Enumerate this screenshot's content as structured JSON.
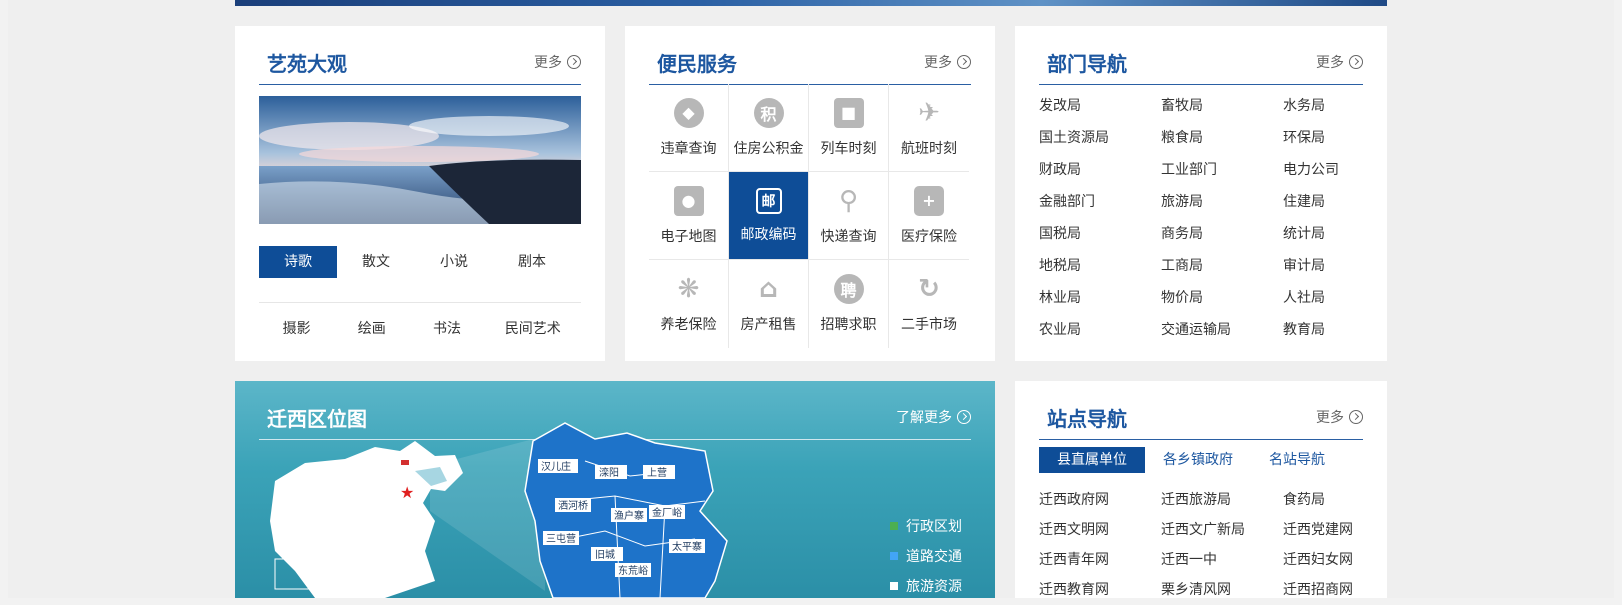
{
  "common": {
    "more_label": "更多"
  },
  "art": {
    "title": "艺苑大观",
    "tabs_row1": [
      "诗歌",
      "散文",
      "小说",
      "剧本"
    ],
    "tabs_row2": [
      "摄影",
      "绘画",
      "书法",
      "民间艺术"
    ],
    "active_tab": "诗歌"
  },
  "service": {
    "title": "便民服务",
    "items": [
      {
        "label": "违章查询",
        "icon": "car-icon"
      },
      {
        "label": "住房公积金",
        "icon": "ji-badge-icon",
        "glyph": "积"
      },
      {
        "label": "列车时刻",
        "icon": "train-icon"
      },
      {
        "label": "航班时刻",
        "icon": "plane-icon"
      },
      {
        "label": "电子地图",
        "icon": "map-pin-icon"
      },
      {
        "label": "邮政编码",
        "icon": "postal-icon",
        "glyph": "邮"
      },
      {
        "label": "快递查询",
        "icon": "search-icon"
      },
      {
        "label": "医疗保险",
        "icon": "medical-kit-icon"
      },
      {
        "label": "养老保险",
        "icon": "asterisk-icon"
      },
      {
        "label": "房产租售",
        "icon": "house-icon"
      },
      {
        "label": "招聘求职",
        "icon": "pin-badge-icon",
        "glyph": "聘"
      },
      {
        "label": "二手市场",
        "icon": "recycle-icon"
      }
    ],
    "active_item": "邮政编码"
  },
  "dept": {
    "title": "部门导航",
    "items": [
      "发改局",
      "畜牧局",
      "水务局",
      "国土资源局",
      "粮食局",
      "环保局",
      "财政局",
      "工业部门",
      "电力公司",
      "金融部门",
      "旅游局",
      "住建局",
      "国税局",
      "商务局",
      "统计局",
      "地税局",
      "工商局",
      "审计局",
      "林业局",
      "物价局",
      "人社局",
      "农业局",
      "交通运输局",
      "教育局"
    ]
  },
  "map": {
    "title": "迁西区位图",
    "more_label": "了解更多",
    "legend": [
      {
        "label": "行政区划",
        "color": "#4caf50"
      },
      {
        "label": "道路交通",
        "color": "#42a5f5"
      },
      {
        "label": "旅游资源",
        "color": "#ffffff"
      }
    ],
    "towns": [
      "汉儿庄",
      "滦阳",
      "上营",
      "洒河桥",
      "渔户寨",
      "金厂峪",
      "三屯营",
      "旧城",
      "太平寨",
      "东荒峪"
    ]
  },
  "site": {
    "title": "站点导航",
    "tabs": [
      "县直属单位",
      "各乡镇政府",
      "名站导航"
    ],
    "active_tab": "县直属单位",
    "items": [
      "迁西政府网",
      "迁西旅游局",
      "食药局",
      "迁西文明网",
      "迁西文广新局",
      "迁西党建网",
      "迁西青年网",
      "迁西一中",
      "迁西妇女网",
      "迁西教育网",
      "栗乡清风网",
      "迁西招商网"
    ]
  },
  "colors": {
    "accent": "#1d57a0",
    "active": "#0e4d97",
    "map_bg": "#3ba3b8"
  }
}
